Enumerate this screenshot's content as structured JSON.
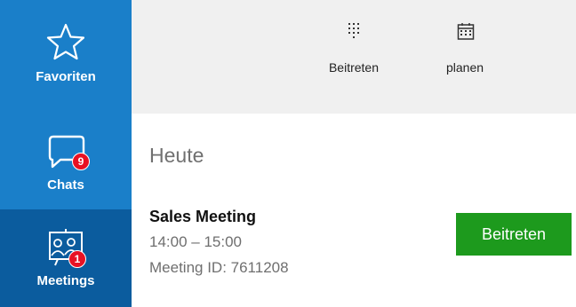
{
  "sidebar": {
    "items": [
      {
        "label": "Favoriten",
        "icon": "star-icon"
      },
      {
        "label": "Chats",
        "icon": "chat-bubble-icon",
        "badge": "9"
      },
      {
        "label": "Meetings",
        "icon": "meeting-board-icon",
        "badge": "1",
        "selected": true
      }
    ]
  },
  "toolbar": {
    "join_label": "Beitreten",
    "schedule_label": "planen"
  },
  "main": {
    "section_title": "Heute",
    "meeting": {
      "title": "Sales Meeting",
      "time": "14:00 – 15:00",
      "id_text": "Meeting ID: 7611208",
      "join_button": "Beitreten"
    }
  },
  "colors": {
    "sidebar": "#1a7fc9",
    "sidebar_selected": "#0b5c9e",
    "badge": "#e81123",
    "join_button": "#1d9a1d",
    "toolbar_bg": "#f0f0f0"
  }
}
